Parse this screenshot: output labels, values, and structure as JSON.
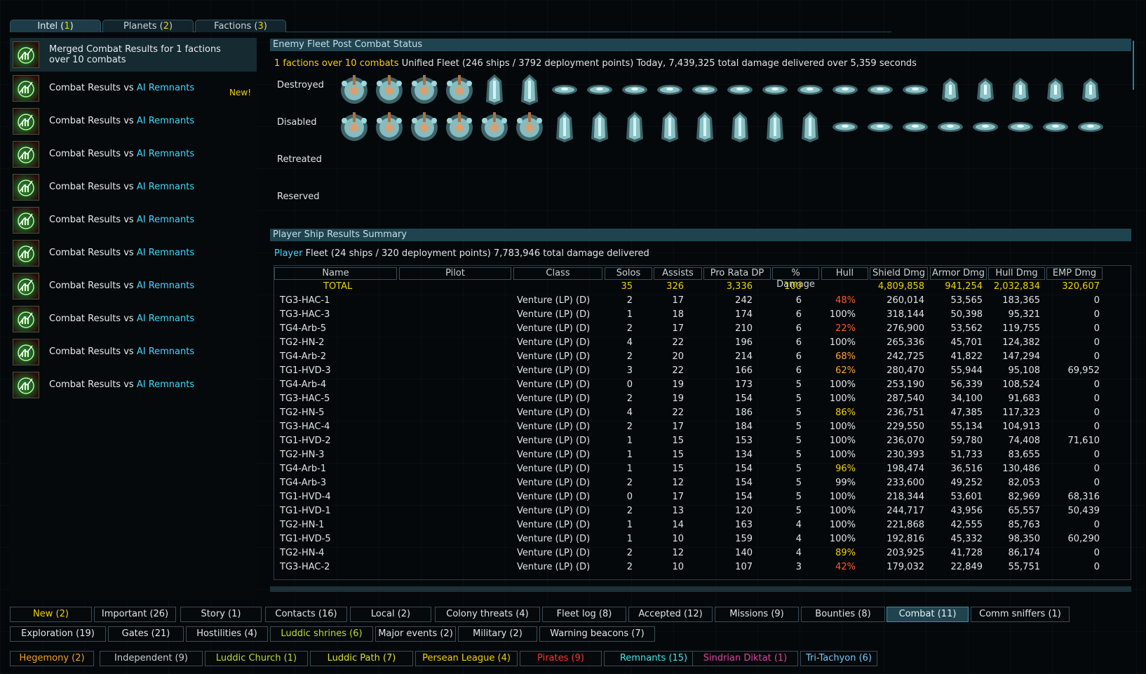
{
  "tabs": [
    {
      "label": "Intel (",
      "num": "1",
      "close": ")"
    },
    {
      "label": "Planets (",
      "num": "2",
      "close": ")"
    },
    {
      "label": "Factions (",
      "num": "3",
      "close": ")"
    }
  ],
  "left_list": {
    "items": [
      {
        "l1": "Merged Combat Results for 1 factions",
        "l2": "over 10 combats",
        "selected": true
      },
      {
        "pre": "Combat Results vs ",
        "acc": "AI Remnants",
        "badge": "New!"
      },
      {
        "pre": "Combat Results vs ",
        "acc": "AI Remnants"
      },
      {
        "pre": "Combat Results vs ",
        "acc": "AI Remnants"
      },
      {
        "pre": "Combat Results vs ",
        "acc": "AI Remnants"
      },
      {
        "pre": "Combat Results vs ",
        "acc": "AI Remnants"
      },
      {
        "pre": "Combat Results vs ",
        "acc": "AI Remnants"
      },
      {
        "pre": "Combat Results vs ",
        "acc": "AI Remnants"
      },
      {
        "pre": "Combat Results vs ",
        "acc": "AI Remnants"
      },
      {
        "pre": "Combat Results vs ",
        "acc": "AI Remnants"
      },
      {
        "pre": "Combat Results vs ",
        "acc": "AI Remnants"
      }
    ]
  },
  "enemy": {
    "header": "Enemy Fleet Post Combat Status",
    "summary_y": "1 factions over 10 combats",
    "summary": " Unified Fleet (246 ships / 3792 deployment points) Today, 7,439,325 total damage delivered over 5,359 seconds",
    "rows": [
      {
        "label": "Destroyed",
        "ships": [
          "capital",
          "capital",
          "capital",
          "capital",
          "cruiser",
          "cruiser",
          "frigate",
          "frigate",
          "frigate",
          "frigate",
          "frigate",
          "frigate",
          "frigate",
          "frigate",
          "frigate",
          "frigate",
          "frigate",
          "destroyer",
          "destroyer",
          "destroyer",
          "destroyer",
          "destroyer"
        ]
      },
      {
        "label": "Disabled",
        "ships": [
          "capital",
          "capital",
          "capital",
          "capital",
          "capital",
          "capital",
          "cruiser",
          "cruiser",
          "cruiser",
          "cruiser",
          "cruiser",
          "cruiser",
          "cruiser",
          "cruiser",
          "frigate",
          "frigate",
          "frigate",
          "frigate",
          "frigate",
          "frigate",
          "frigate",
          "frigate"
        ]
      },
      {
        "label": "Retreated",
        "ships": []
      },
      {
        "label": "Reserved",
        "ships": []
      }
    ]
  },
  "player": {
    "header": "Player Ship Results Summary",
    "summary_b": "Player",
    "summary": " Fleet (24 ships / 320 deployment points) 7,783,946 total damage delivered",
    "columns": [
      "Name",
      "Pilot",
      "Class",
      "Solos",
      "Assists",
      "Pro Rata DP",
      "% Damage",
      "Hull",
      "Shield Dmg",
      "Armor Dmg",
      "Hull Dmg",
      "EMP Dmg"
    ],
    "total": {
      "name": "TOTAL",
      "solos": "35",
      "assists": "326",
      "dp": "3,336",
      "pct": "100",
      "hull": "",
      "shield": "4,809,858",
      "armor": "941,254",
      "hulldmg": "2,032,834",
      "emp": "320,607"
    },
    "rows": [
      {
        "name": "TG3-HAC-1",
        "cls": "Venture (LP) (D)",
        "solos": "2",
        "assists": "17",
        "dp": "242",
        "pct": "6",
        "hull": "48%",
        "hc": "red",
        "shield": "260,014",
        "armor": "53,565",
        "hulldmg": "183,365",
        "emp": "0"
      },
      {
        "name": "TG3-HAC-3",
        "cls": "Venture (LP) (D)",
        "solos": "1",
        "assists": "18",
        "dp": "174",
        "pct": "6",
        "hull": "100%",
        "hc": "def",
        "shield": "318,144",
        "armor": "50,398",
        "hulldmg": "95,321",
        "emp": "0"
      },
      {
        "name": "TG4-Arb-5",
        "cls": "Venture (LP) (D)",
        "solos": "2",
        "assists": "17",
        "dp": "210",
        "pct": "6",
        "hull": "22%",
        "hc": "red",
        "shield": "276,900",
        "armor": "53,562",
        "hulldmg": "119,755",
        "emp": "0"
      },
      {
        "name": "TG2-HN-2",
        "cls": "Venture (LP) (D)",
        "solos": "4",
        "assists": "22",
        "dp": "196",
        "pct": "6",
        "hull": "100%",
        "hc": "def",
        "shield": "265,336",
        "armor": "45,701",
        "hulldmg": "124,382",
        "emp": "0"
      },
      {
        "name": "TG4-Arb-2",
        "cls": "Venture (LP) (D)",
        "solos": "2",
        "assists": "20",
        "dp": "214",
        "pct": "6",
        "hull": "68%",
        "hc": "ora",
        "shield": "242,725",
        "armor": "41,822",
        "hulldmg": "147,294",
        "emp": "0"
      },
      {
        "name": "TG1-HVD-3",
        "cls": "Venture (LP) (D)",
        "solos": "3",
        "assists": "22",
        "dp": "166",
        "pct": "6",
        "hull": "62%",
        "hc": "ora",
        "shield": "280,470",
        "armor": "55,944",
        "hulldmg": "95,108",
        "emp": "69,952"
      },
      {
        "name": "TG4-Arb-4",
        "cls": "Venture (LP) (D)",
        "solos": "0",
        "assists": "19",
        "dp": "173",
        "pct": "5",
        "hull": "100%",
        "hc": "def",
        "shield": "253,190",
        "armor": "56,339",
        "hulldmg": "108,524",
        "emp": "0"
      },
      {
        "name": "TG3-HAC-5",
        "cls": "Venture (LP) (D)",
        "solos": "2",
        "assists": "19",
        "dp": "154",
        "pct": "5",
        "hull": "100%",
        "hc": "def",
        "shield": "287,540",
        "armor": "34,100",
        "hulldmg": "91,683",
        "emp": "0"
      },
      {
        "name": "TG2-HN-5",
        "cls": "Venture (LP) (D)",
        "solos": "4",
        "assists": "22",
        "dp": "186",
        "pct": "5",
        "hull": "86%",
        "hc": "yel",
        "shield": "236,751",
        "armor": "47,385",
        "hulldmg": "117,323",
        "emp": "0"
      },
      {
        "name": "TG3-HAC-4",
        "cls": "Venture (LP) (D)",
        "solos": "2",
        "assists": "17",
        "dp": "184",
        "pct": "5",
        "hull": "100%",
        "hc": "def",
        "shield": "229,550",
        "armor": "55,134",
        "hulldmg": "104,913",
        "emp": "0"
      },
      {
        "name": "TG1-HVD-2",
        "cls": "Venture (LP) (D)",
        "solos": "1",
        "assists": "15",
        "dp": "153",
        "pct": "5",
        "hull": "100%",
        "hc": "def",
        "shield": "236,070",
        "armor": "59,780",
        "hulldmg": "74,408",
        "emp": "71,610"
      },
      {
        "name": "TG2-HN-3",
        "cls": "Venture (LP) (D)",
        "solos": "1",
        "assists": "15",
        "dp": "134",
        "pct": "5",
        "hull": "100%",
        "hc": "def",
        "shield": "230,393",
        "armor": "51,733",
        "hulldmg": "83,655",
        "emp": "0"
      },
      {
        "name": "TG4-Arb-1",
        "cls": "Venture (LP) (D)",
        "solos": "1",
        "assists": "15",
        "dp": "154",
        "pct": "5",
        "hull": "96%",
        "hc": "yel",
        "shield": "198,474",
        "armor": "36,516",
        "hulldmg": "130,486",
        "emp": "0"
      },
      {
        "name": "TG4-Arb-3",
        "cls": "Venture (LP) (D)",
        "solos": "2",
        "assists": "12",
        "dp": "154",
        "pct": "5",
        "hull": "99%",
        "hc": "def",
        "shield": "233,600",
        "armor": "49,252",
        "hulldmg": "82,053",
        "emp": "0"
      },
      {
        "name": "TG1-HVD-4",
        "cls": "Venture (LP) (D)",
        "solos": "0",
        "assists": "17",
        "dp": "154",
        "pct": "5",
        "hull": "100%",
        "hc": "def",
        "shield": "218,344",
        "armor": "53,601",
        "hulldmg": "82,969",
        "emp": "68,316"
      },
      {
        "name": "TG1-HVD-1",
        "cls": "Venture (LP) (D)",
        "solos": "2",
        "assists": "13",
        "dp": "120",
        "pct": "5",
        "hull": "100%",
        "hc": "def",
        "shield": "244,717",
        "armor": "43,956",
        "hulldmg": "65,557",
        "emp": "50,439"
      },
      {
        "name": "TG2-HN-1",
        "cls": "Venture (LP) (D)",
        "solos": "1",
        "assists": "14",
        "dp": "163",
        "pct": "4",
        "hull": "100%",
        "hc": "def",
        "shield": "221,868",
        "armor": "42,555",
        "hulldmg": "85,763",
        "emp": "0"
      },
      {
        "name": "TG1-HVD-5",
        "cls": "Venture (LP) (D)",
        "solos": "1",
        "assists": "10",
        "dp": "159",
        "pct": "4",
        "hull": "100%",
        "hc": "def",
        "shield": "192,816",
        "armor": "45,332",
        "hulldmg": "98,350",
        "emp": "60,290"
      },
      {
        "name": "TG2-HN-4",
        "cls": "Venture (LP) (D)",
        "solos": "2",
        "assists": "12",
        "dp": "140",
        "pct": "4",
        "hull": "89%",
        "hc": "yel",
        "shield": "203,925",
        "armor": "41,728",
        "hulldmg": "86,174",
        "emp": "0"
      },
      {
        "name": "TG3-HAC-2",
        "cls": "Venture (LP) (D)",
        "solos": "2",
        "assists": "10",
        "dp": "107",
        "pct": "3",
        "hull": "42%",
        "hc": "red",
        "shield": "179,032",
        "armor": "22,849",
        "hulldmg": "55,751",
        "emp": "0"
      }
    ]
  },
  "filters": {
    "row1": [
      {
        "label": "New (2)",
        "color": "#f0d000"
      },
      {
        "label": "Important (26)",
        "color": "#dfe4e6"
      },
      {
        "label": "Story (1)",
        "color": "#dfe4e6"
      },
      {
        "label": "Contacts (16)",
        "color": "#dfe4e6"
      },
      {
        "label": "Local (2)",
        "color": "#dfe4e6"
      },
      {
        "label": "Colony threats (4)",
        "color": "#dfe4e6"
      },
      {
        "label": "Fleet log (8)",
        "color": "#dfe4e6"
      },
      {
        "label": "Accepted (12)",
        "color": "#dfe4e6"
      },
      {
        "label": "Missions (9)",
        "color": "#dfe4e6"
      },
      {
        "label": "Bounties (8)",
        "color": "#dfe4e6"
      },
      {
        "label": "Combat (11)",
        "color": "#e8f0f3",
        "on": true
      },
      {
        "label": "Comm sniffers (1)",
        "color": "#dfe4e6"
      }
    ],
    "row2": [
      {
        "label": "Exploration (19)",
        "color": "#dfe4e6"
      },
      {
        "label": "Gates (21)",
        "color": "#dfe4e6"
      },
      {
        "label": "Hostilities (4)",
        "color": "#dfe4e6"
      },
      {
        "label": "Luddic shrines (6)",
        "color": "#b6e02a"
      },
      {
        "label": "Major events (2)",
        "color": "#dfe4e6"
      },
      {
        "label": "Military (2)",
        "color": "#dfe4e6"
      },
      {
        "label": "Warning beacons (7)",
        "color": "#dfe4e6"
      }
    ],
    "row3": [
      {
        "label": "Hegemony (2)",
        "color": "#f0a020"
      },
      {
        "label": "Independent (9)",
        "color": "#c8cdd0"
      },
      {
        "label": "Luddic Church (1)",
        "color": "#b6e02a"
      },
      {
        "label": "Luddic Path (7)",
        "color": "#d8e030"
      },
      {
        "label": "Persean League (4)",
        "color": "#f0d000"
      },
      {
        "label": "Pirates (9)",
        "color": "#ff3030"
      },
      {
        "label": "Remnants (15)",
        "color": "#40e8e8"
      },
      {
        "label": "Sindrian Diktat (1)",
        "color": "#e040a0"
      },
      {
        "label": "Tri-Tachyon (6)",
        "color": "#70c8ff"
      }
    ]
  }
}
